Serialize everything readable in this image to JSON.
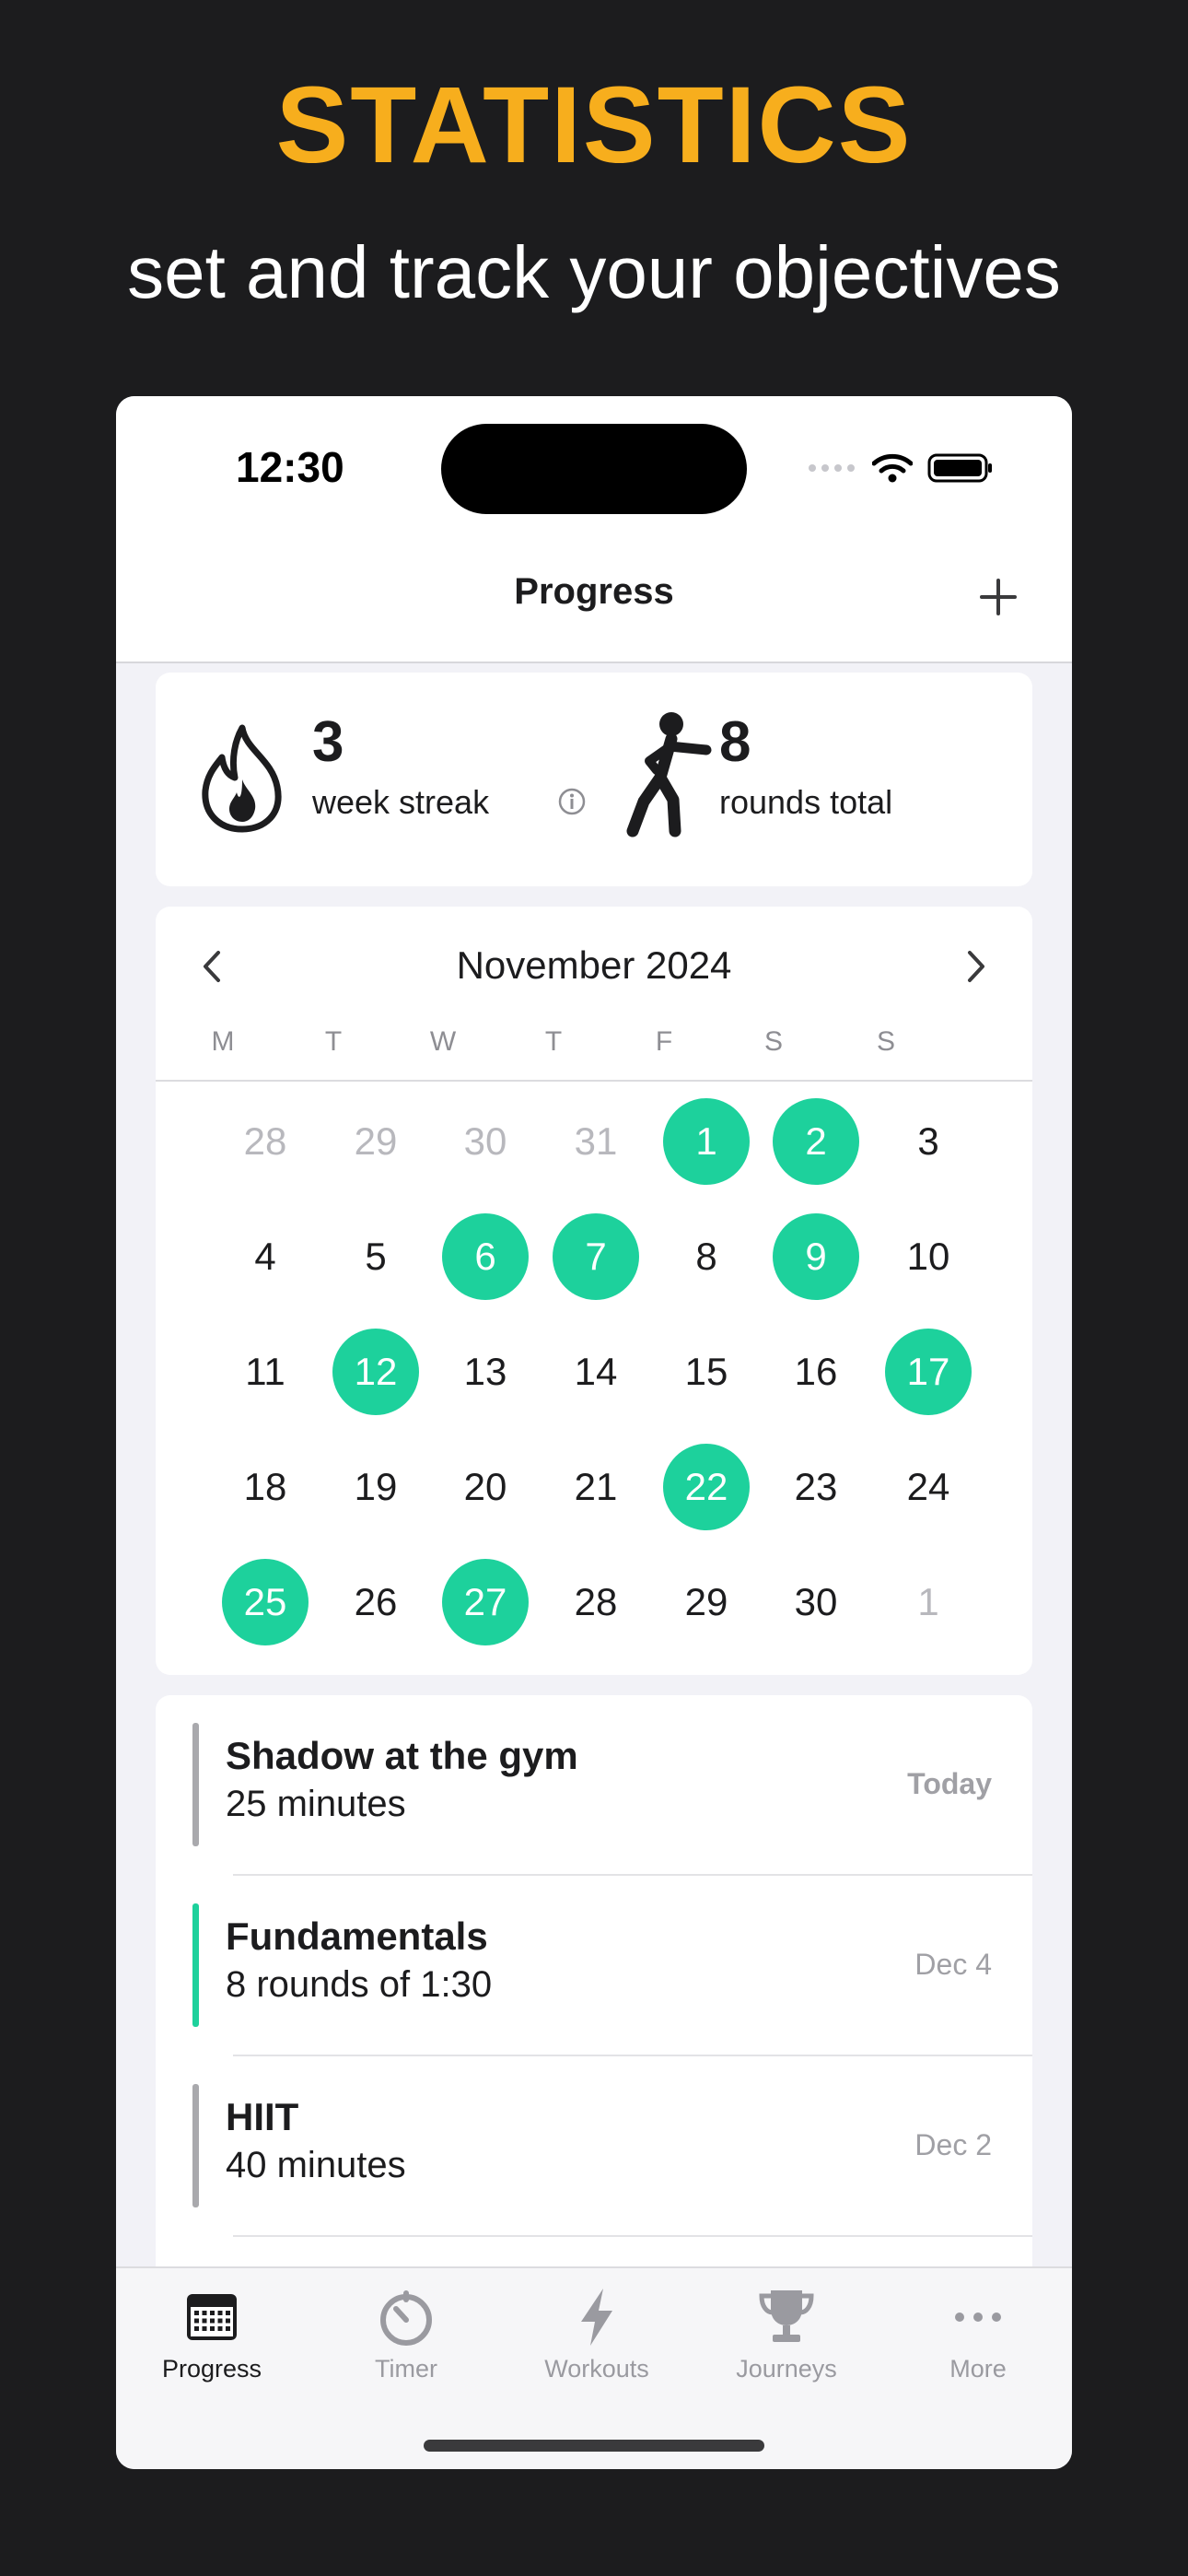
{
  "promo": {
    "headline": "STATISTICS",
    "subhead": "set and track your objectives"
  },
  "status_bar": {
    "time": "12:30"
  },
  "nav": {
    "title": "Progress"
  },
  "stats": {
    "streak_value": "3",
    "streak_label": "week streak",
    "rounds_value": "8",
    "rounds_label": "rounds total"
  },
  "calendar": {
    "month": "November 2024",
    "weekdays": [
      "M",
      "T",
      "W",
      "T",
      "F",
      "S",
      "S"
    ],
    "weeks": [
      [
        {
          "d": "28",
          "m": true
        },
        {
          "d": "29",
          "m": true
        },
        {
          "d": "30",
          "m": true
        },
        {
          "d": "31",
          "m": true
        },
        {
          "d": "1",
          "a": true
        },
        {
          "d": "2",
          "a": true
        },
        {
          "d": "3"
        }
      ],
      [
        {
          "d": "4"
        },
        {
          "d": "5"
        },
        {
          "d": "6",
          "a": true
        },
        {
          "d": "7",
          "a": true
        },
        {
          "d": "8"
        },
        {
          "d": "9",
          "a": true
        },
        {
          "d": "10"
        }
      ],
      [
        {
          "d": "11"
        },
        {
          "d": "12",
          "a": true
        },
        {
          "d": "13"
        },
        {
          "d": "14"
        },
        {
          "d": "15"
        },
        {
          "d": "16"
        },
        {
          "d": "17",
          "a": true
        }
      ],
      [
        {
          "d": "18"
        },
        {
          "d": "19"
        },
        {
          "d": "20"
        },
        {
          "d": "21"
        },
        {
          "d": "22",
          "a": true
        },
        {
          "d": "23"
        },
        {
          "d": "24"
        }
      ],
      [
        {
          "d": "25",
          "a": true
        },
        {
          "d": "26"
        },
        {
          "d": "27",
          "a": true
        },
        {
          "d": "28"
        },
        {
          "d": "29"
        },
        {
          "d": "30"
        },
        {
          "d": "1",
          "m": true
        }
      ]
    ]
  },
  "workouts": [
    {
      "title": "Shadow at the gym",
      "subtitle": "25 minutes",
      "date": "Today",
      "bar_color": "#a9a9ad"
    },
    {
      "title": "Fundamentals",
      "subtitle": "8 rounds of 1:30",
      "date": "Dec 4",
      "bar_color": "#1dd19c"
    },
    {
      "title": "HIIT",
      "subtitle": "40 minutes",
      "date": "Dec 2",
      "bar_color": "#a9a9ad"
    }
  ],
  "tabs": [
    {
      "label": "Progress",
      "icon": "calendar-icon",
      "active": true
    },
    {
      "label": "Timer",
      "icon": "timer-icon"
    },
    {
      "label": "Workouts",
      "icon": "bolt-icon"
    },
    {
      "label": "Journeys",
      "icon": "trophy-icon"
    },
    {
      "label": "More",
      "icon": "more-icon"
    }
  ],
  "colors": {
    "accent_yellow": "#f7ae1d",
    "accent_green": "#1dd19c",
    "background": "#1c1c1e"
  }
}
